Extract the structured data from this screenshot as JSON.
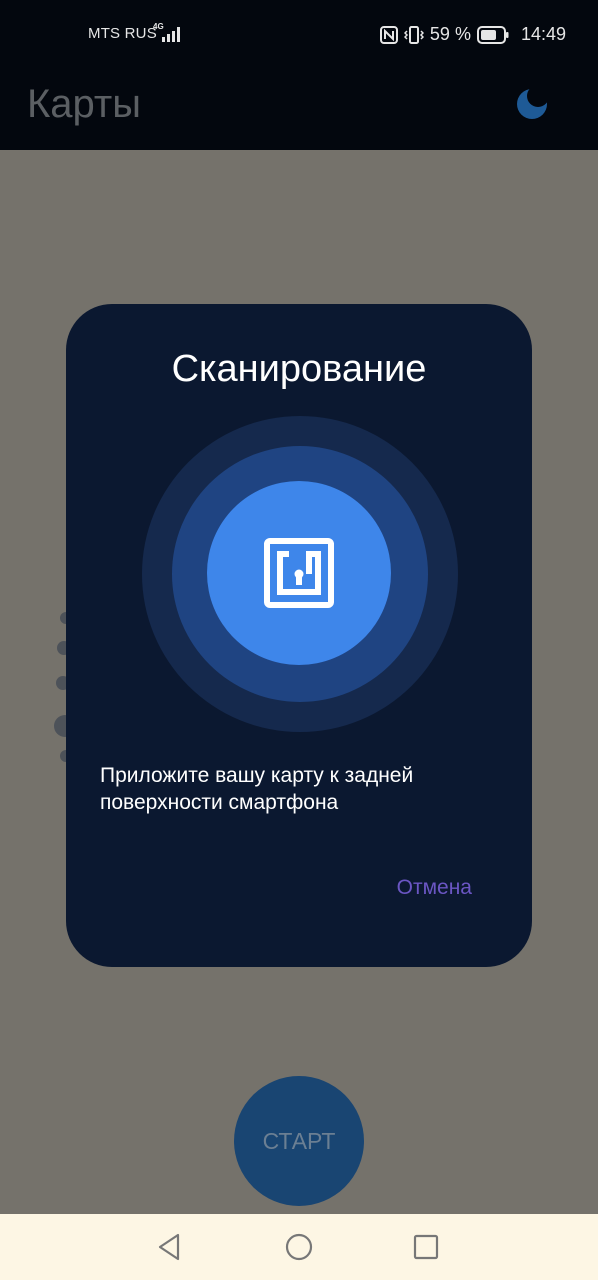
{
  "status_bar": {
    "carrier": "MTS RUS",
    "network_type": "4G",
    "battery_percent_text": "59 %",
    "time": "14:49",
    "icons": [
      "signal-icon",
      "nfc-icon",
      "vibrate-icon",
      "battery-icon"
    ]
  },
  "app_bar": {
    "title": "Карты",
    "theme_icon": "moon-icon"
  },
  "main": {
    "start_button_label": "СТАРТ"
  },
  "scan_dialog": {
    "title": "Сканирование",
    "icon": "nfc-icon",
    "message": "Приложите вашу карту к задней поверхности смартфона",
    "cancel_label": "Отмена"
  },
  "nav_bar": {
    "buttons": [
      "back-icon",
      "home-icon",
      "recents-icon"
    ]
  },
  "colors": {
    "status_bar_bg": "#03070e",
    "scrim": "#75726b",
    "dialog_bg": "#0b1830",
    "accent_blue": "#3e86ea",
    "cancel_purple": "#6b56c4",
    "start_button": "#194572",
    "nav_bar_bg": "#fdf6e4"
  }
}
